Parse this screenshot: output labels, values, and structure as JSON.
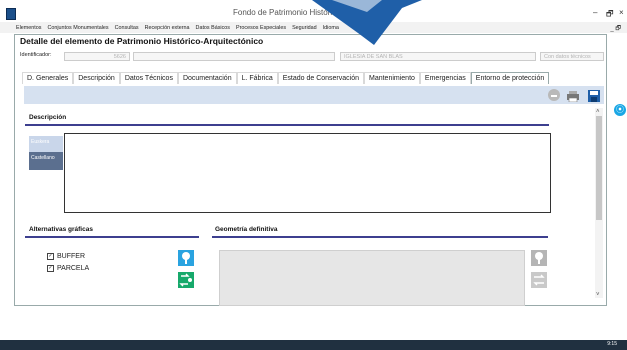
{
  "window": {
    "title": "Fondo de Patrimonio Histórico-Arquitectónico",
    "minimize": "–",
    "maximize": "🗗",
    "close": "×"
  },
  "menu": {
    "items": [
      "Elementos",
      "Conjuntos Monumentales",
      "Consultas",
      "Recepción externa",
      "Datos Básicos",
      "Procesos Especiales",
      "Seguridad",
      "Idioma"
    ],
    "mdi_buttons": "_ 🗗"
  },
  "form": {
    "title": "Detalle del elemento de Patrimonio Histórico-Arquitectónico",
    "identificador_label": "Identificador:",
    "identificador_value": "5626",
    "name_value": "IGLESIA DE SAN BLAS",
    "status_value": "Con datos técnicos"
  },
  "tabs": [
    "D. Generales",
    "Descripción",
    "Datos Técnicos",
    "Documentación",
    "L. Fábrica",
    "Estado de Conservación",
    "Mantenimiento",
    "Emergencias",
    "Entorno de protección"
  ],
  "descripcion": {
    "title": "Descripción",
    "lang_tabs": [
      "Euskera",
      "Castellano"
    ],
    "text": ""
  },
  "alternativas": {
    "title": "Alternativas gráficas",
    "options": [
      {
        "label": "BUFFER",
        "checked": true
      },
      {
        "label": "PARCELA",
        "checked": true
      }
    ]
  },
  "geometria": {
    "title": "Geometría definitiva"
  },
  "taskbar": {
    "time": "9:15"
  },
  "colors": {
    "accent_rule": "#3d3f8f",
    "toolbar_bg": "#d6e1f0",
    "cursor_blue": "#1f5fa8"
  }
}
